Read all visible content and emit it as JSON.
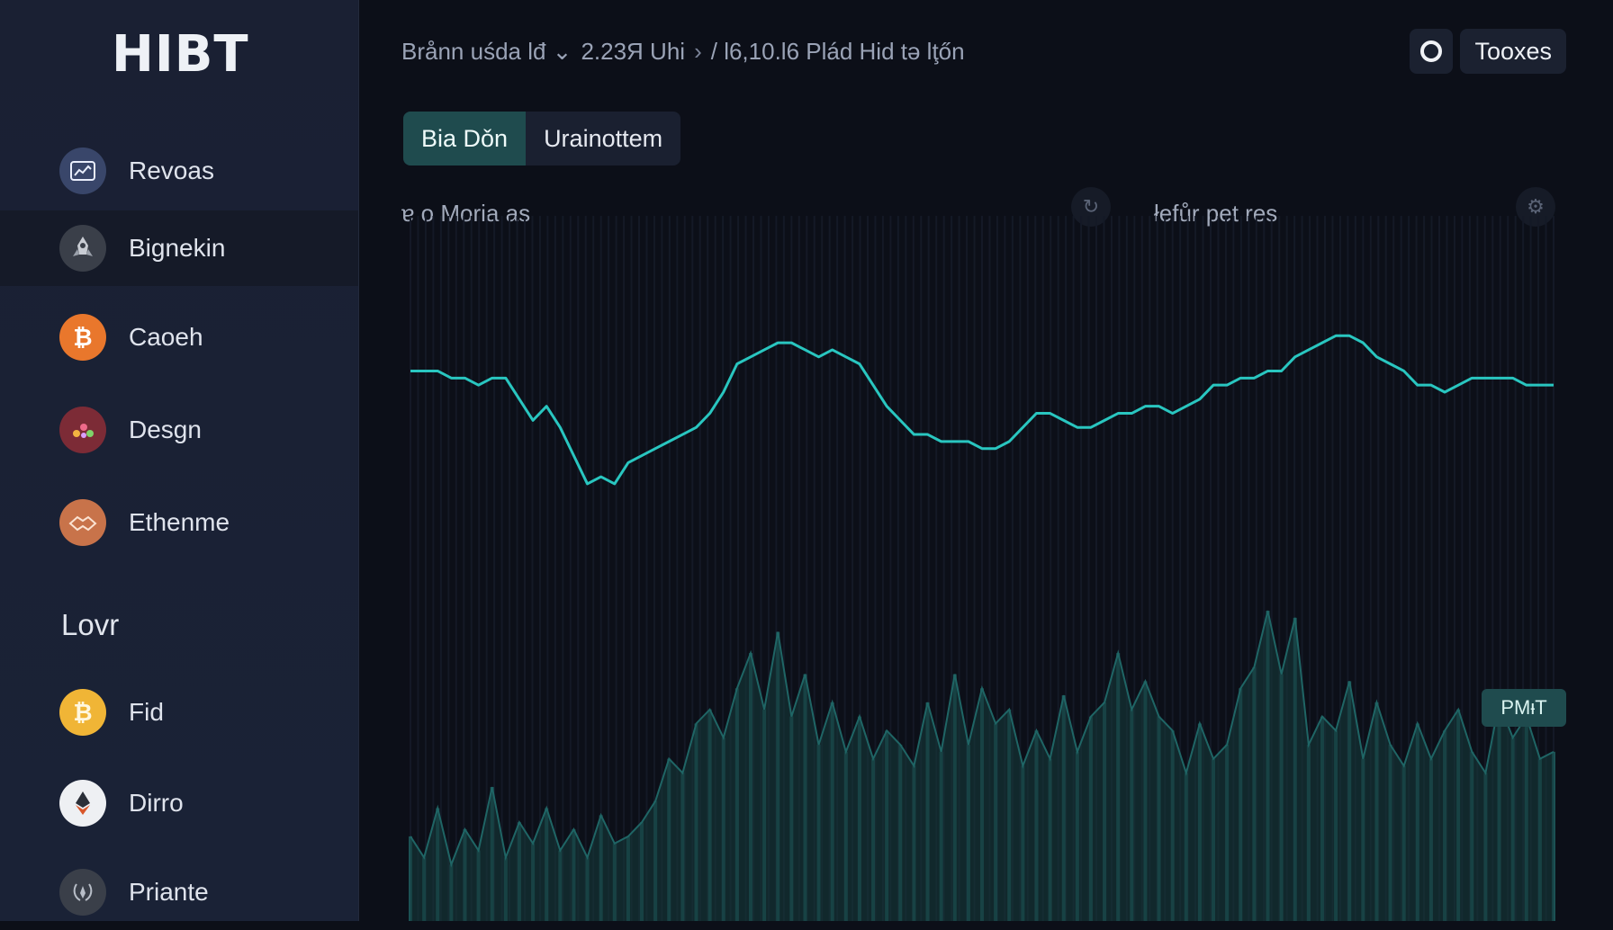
{
  "app": {
    "logo": "HIBT"
  },
  "sidebar": {
    "items": [
      {
        "label": "Revoas",
        "icon": "chart-card-icon",
        "active": false
      },
      {
        "label": "Bignekin",
        "icon": "rocket-icon",
        "active": true
      },
      {
        "label": "Caoeh",
        "icon": "bitcoin-icon",
        "active": false
      },
      {
        "label": "Desgn",
        "icon": "dots-cluster-icon",
        "active": false
      },
      {
        "label": "Ethenme",
        "icon": "handshake-icon",
        "active": false
      }
    ],
    "section_title": "Lovr",
    "section_items": [
      {
        "label": "Fid",
        "icon": "bitcoin-icon"
      },
      {
        "label": "Dirro",
        "icon": "ethereum-icon"
      },
      {
        "label": "Priante",
        "icon": "wreath-icon"
      }
    ]
  },
  "header": {
    "breadcrumb": [
      "Brånn uśda lđ ⌄",
      "2.23Я Uhi",
      "›",
      "/ l6,10.l6 Plád Hid tə lţőn"
    ],
    "tools_label": "Tooxes"
  },
  "tabs": [
    {
      "label": "Bia Dǒn",
      "active": true
    },
    {
      "label": "Urainottem",
      "active": false
    }
  ],
  "chart_panel": {
    "left_label": "ɐ o Moria as",
    "right_label": "łefůr pet res",
    "pill_label": "PMᵻT"
  },
  "chart_data": {
    "type": "line",
    "title": "",
    "xlabel": "",
    "ylabel": "",
    "ylim": [
      0,
      100
    ],
    "grid": true,
    "series": [
      {
        "values": [
          78,
          78,
          78,
          77,
          77,
          76,
          77,
          77,
          74,
          71,
          73,
          70,
          66,
          62,
          63,
          62,
          65,
          66,
          67,
          68,
          69,
          70,
          72,
          75,
          79,
          80,
          81,
          82,
          82,
          81,
          80,
          81,
          80,
          79,
          76,
          73,
          71,
          69,
          69,
          68,
          68,
          68,
          67,
          67,
          68,
          70,
          72,
          72,
          71,
          70,
          70,
          71,
          72,
          72,
          73,
          73,
          72,
          73,
          74,
          76,
          76,
          77,
          77,
          78,
          78,
          80,
          81,
          82,
          83,
          83,
          82,
          80,
          79,
          78,
          76,
          76,
          75,
          76,
          77,
          77,
          77,
          77,
          76,
          76,
          76
        ]
      },
      {
        "values": [
          12,
          9,
          16,
          8,
          13,
          10,
          19,
          9,
          14,
          11,
          16,
          10,
          13,
          9,
          15,
          11,
          12,
          14,
          17,
          23,
          21,
          28,
          30,
          26,
          33,
          38,
          30,
          41,
          29,
          35,
          25,
          31,
          24,
          29,
          23,
          27,
          25,
          22,
          31,
          24,
          35,
          25,
          33,
          28,
          30,
          22,
          27,
          23,
          32,
          24,
          29,
          31,
          38,
          30,
          34,
          29,
          27,
          21,
          28,
          23,
          25,
          33,
          36,
          44,
          35,
          43,
          25,
          29,
          27,
          34,
          23,
          31,
          25,
          22,
          28,
          23,
          27,
          30,
          24,
          21,
          31,
          26,
          29,
          23,
          24
        ]
      }
    ]
  },
  "colors": {
    "accent": "#29c6c0",
    "sidebar_bg": "#1a2033",
    "main_bg": "#0c0f18",
    "tab_active": "#1f4b4e"
  }
}
